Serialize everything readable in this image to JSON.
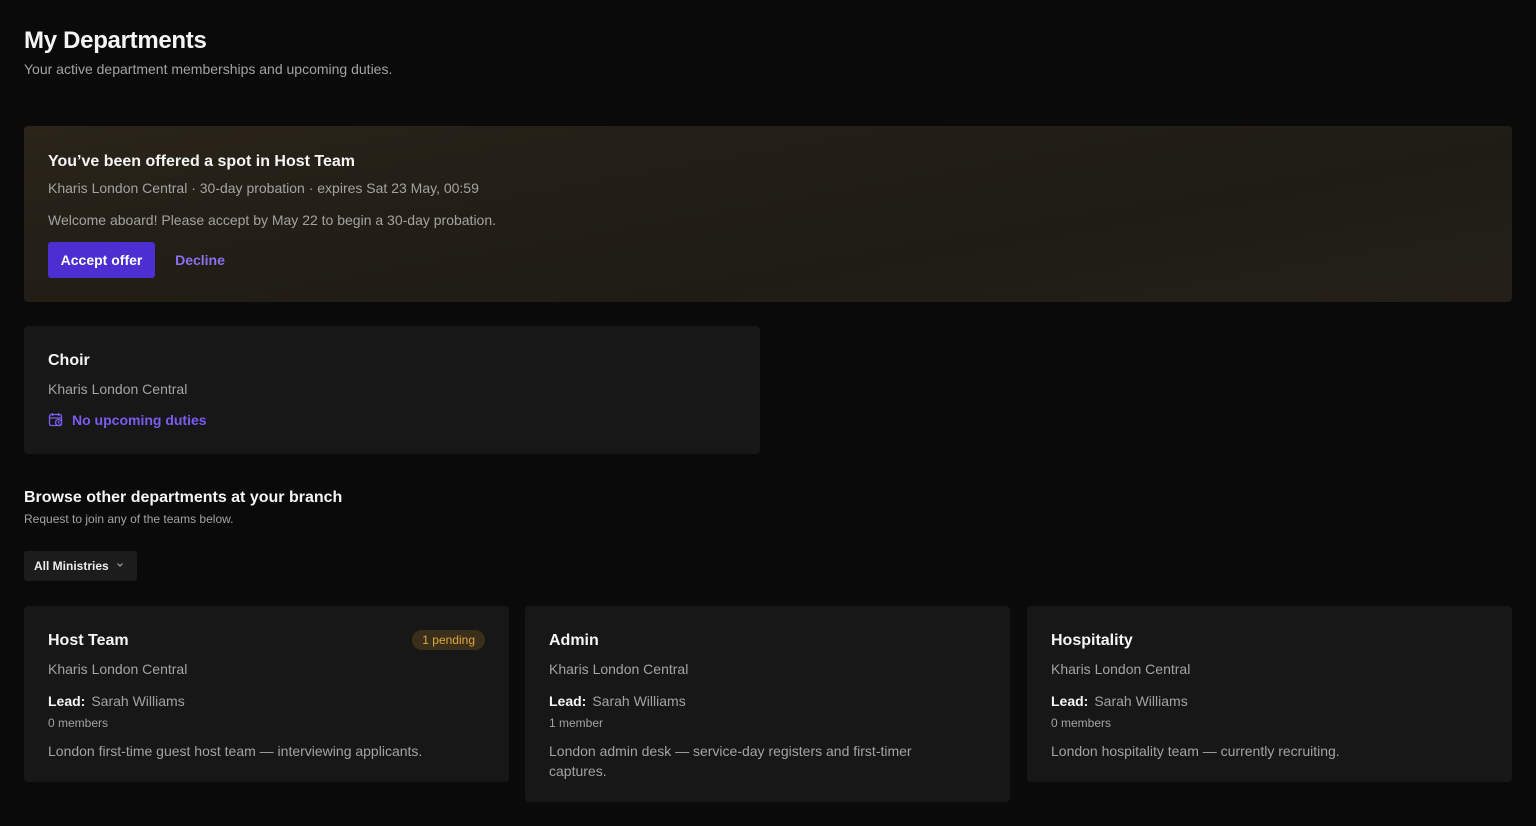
{
  "header": {
    "title": "My Departments",
    "subtitle": "Your active department memberships and upcoming duties."
  },
  "offer": {
    "title": "You’ve been offered a spot in Host Team",
    "meta": "Kharis London Central · 30-day probation · expires Sat 23 May, 00:59",
    "message": "Welcome aboard! Please accept by May 22 to begin a 30-day probation.",
    "accept_label": "Accept offer",
    "decline_label": "Decline"
  },
  "memberships": [
    {
      "name": "Choir",
      "branch": "Kharis London Central",
      "duties_label": "No upcoming duties",
      "duties_icon": "calendar-clock-icon"
    }
  ],
  "browse": {
    "title": "Browse other departments at your branch",
    "subtitle": "Request to join any of the teams below.",
    "filter_label": "All Ministries",
    "filter_icon": "chevron-down-icon",
    "lead_label": "Lead:",
    "departments": [
      {
        "name": "Host Team",
        "branch": "Kharis London Central",
        "lead": "Sarah Williams",
        "members": "0 members",
        "description": "London first-time guest host team — interviewing applicants.",
        "badge": "1 pending"
      },
      {
        "name": "Admin",
        "branch": "Kharis London Central",
        "lead": "Sarah Williams",
        "members": "1 member",
        "description": "London admin desk — service-day registers and first-timer captures."
      },
      {
        "name": "Hospitality",
        "branch": "Kharis London Central",
        "lead": "Sarah Williams",
        "members": "0 members",
        "description": "London hospitality team — currently recruiting."
      }
    ]
  },
  "colors": {
    "background": "#0a0a0a",
    "card": "#171717",
    "accent": "#4c2fd0",
    "link": "#8b70f0",
    "badge_bg": "#3a2f1a",
    "badge_text": "#e0a83a"
  }
}
